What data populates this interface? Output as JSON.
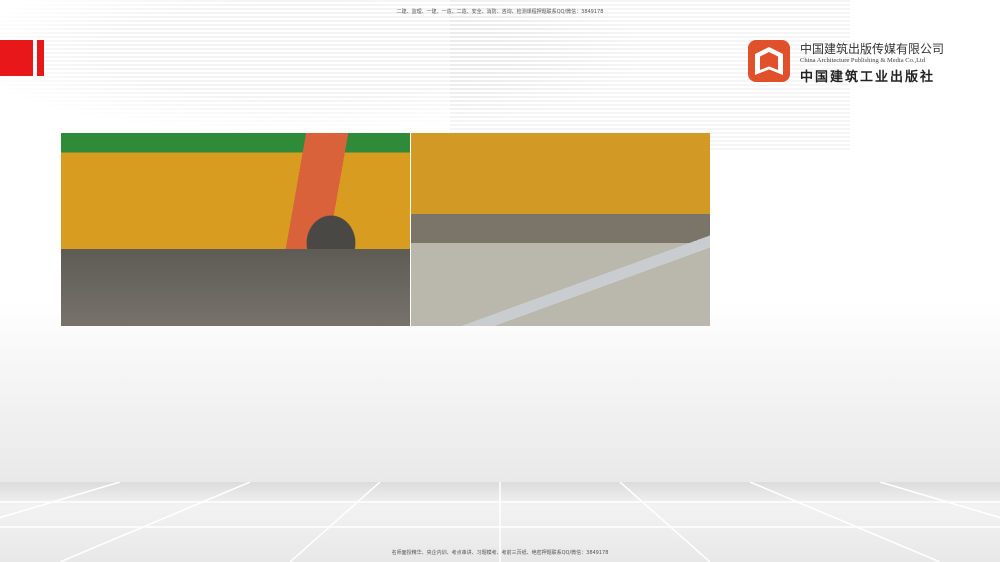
{
  "header": {
    "top_note": "二建、监理、一建、一造、二造、安全、消防、咨询、检测课程押题联系QQ/微信：3849178"
  },
  "logo": {
    "name_cn": "中国建筑出版传媒有限公司",
    "name_en": "China Architecture Publishing & Media Co.,Ltd",
    "name_cn_calligraphy": "中国建筑工业出版社"
  },
  "footer": {
    "bottom_note": "名师面授精华、央企内训、考点串讲、习题模考、考前三页纸、绝密押题联系QQ/微信：3849178"
  },
  "colors": {
    "accent": "#e8171a",
    "logo": "#e0502a"
  }
}
